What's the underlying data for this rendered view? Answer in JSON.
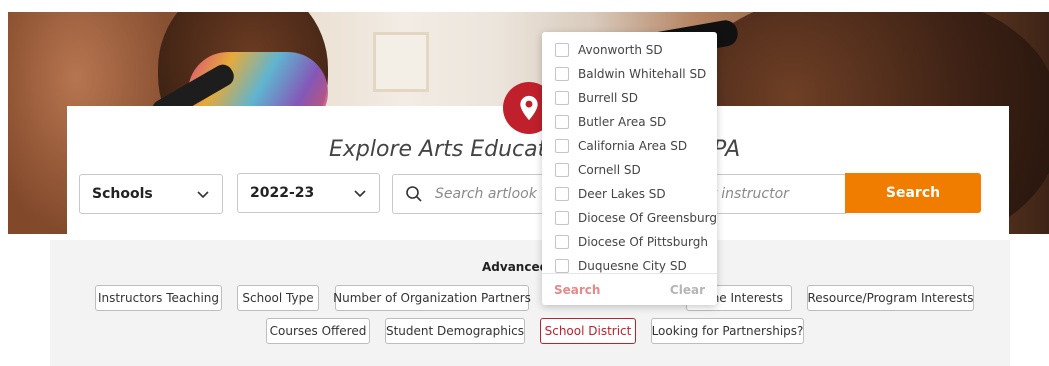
{
  "hero": {
    "headline": "Explore Arts Educatio",
    "headline_tail": "PA"
  },
  "filters": {
    "type_select": "Schools",
    "year_select": "2022-23",
    "search_placeholder": "Search artlook by sc",
    "search_placeholder_tail": "r instructor",
    "search_button": "Search"
  },
  "advanced": {
    "title": "Advanced",
    "chips_row1": [
      "Instructors Teaching",
      "School Type",
      "Number of Organization Partners",
      "ine Interests",
      "Resource/Program Interests"
    ],
    "chips_row2": [
      "Courses Offered",
      "Student Demographics",
      "School District",
      "Looking for Partnerships?"
    ],
    "active_chip": "School District"
  },
  "dropdown": {
    "options": [
      "Avonworth SD",
      "Baldwin Whitehall SD",
      "Burrell SD",
      "Butler Area SD",
      "California Area SD",
      "Cornell SD",
      "Deer Lakes SD",
      "Diocese Of Greensburg",
      "Diocese Of Pittsburgh",
      "Duquesne City SD"
    ],
    "search_label": "Search",
    "clear_label": "Clear"
  },
  "colors": {
    "brand_red": "#c0202c",
    "search_orange": "#f07c00",
    "panel_grey": "#f3f3f3"
  },
  "icons": [
    "map-pin-icon",
    "chevron-down-icon",
    "search-icon"
  ]
}
